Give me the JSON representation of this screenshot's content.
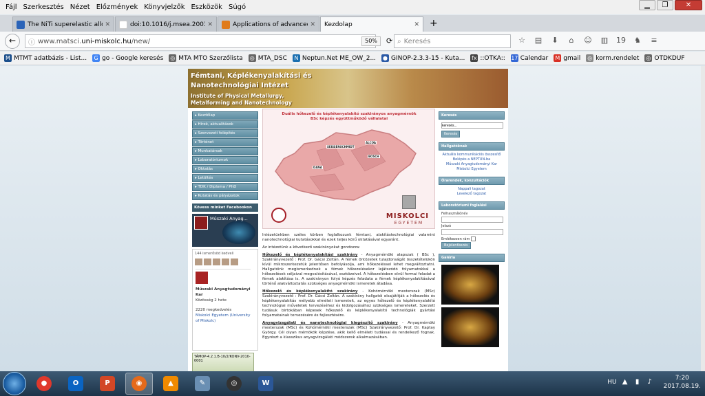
{
  "menu": [
    "Fájl",
    "Szerkesztés",
    "Nézet",
    "Előzmények",
    "Könyvjelzők",
    "Eszközök",
    "Súgó"
  ],
  "window_controls": {
    "minimize": "▁",
    "maximize": "❐",
    "close": "✕"
  },
  "tabs": [
    {
      "label": "The NiTi superelastic alloy ap",
      "favicon_color": "#2a63b8"
    },
    {
      "label": "doi:10.1016/j.msea.2003.12.061 - S",
      "favicon_color": "#ffffff"
    },
    {
      "label": "Applications of advanced tra",
      "favicon_color": "#e07b1a"
    },
    {
      "label": "Kezdolap",
      "favicon_color": "#ffffff",
      "active": true
    }
  ],
  "nav": {
    "back_icon": "←",
    "url_prefix": "www.matsci.",
    "url_domain": "uni-miskolc.hu",
    "url_suffix": "/new/",
    "zoom": "50%",
    "search_placeholder": "Keresés",
    "new_tab": "+",
    "reload": "⟳",
    "icons": [
      "☆",
      "▤",
      "⬇",
      "⌂",
      "☺",
      "▥",
      "19",
      "♞",
      "≡"
    ]
  },
  "bookmarks": [
    {
      "label": "MTMT adatbázis - List...",
      "color": "#1b4f8c"
    },
    {
      "label": "go - Google keresés",
      "color": "#4285f4"
    },
    {
      "label": "MTA MTO Szerzőlista",
      "color": "#666"
    },
    {
      "label": "MTA_DSC",
      "color": "#666"
    },
    {
      "label": "Neptun.Net ME_OW_2...",
      "color": "#1a6fb0"
    },
    {
      "label": "GINOP-2.3.3-15 - Kuta...",
      "color": "#2b5aa6"
    },
    {
      "label": "::OTKA::",
      "color": "#444"
    },
    {
      "label": "Calendar",
      "color": "#3367d6"
    },
    {
      "label": "gmail",
      "color": "#d93025"
    },
    {
      "label": "korm.rendelet",
      "color": "#888"
    },
    {
      "label": "OTDKDUF",
      "color": "#666"
    }
  ],
  "site": {
    "title_hu": "Fémtani, Képlékenyalakítási és Nanotechnológiai Intézet",
    "title_en": "Institute of Physical Metallurgy, Metalforming and Nanotechnology",
    "nav_items": [
      "Kezdőlap",
      "Hírek, aktualitások",
      "Szervezeti felépítés",
      "Történet",
      "Munkatársak",
      "Laboratóriumok",
      "Oktatás",
      "Letöltés",
      "TDK / Diploma / PhD",
      "Kutatás és pályázatok"
    ],
    "facebook_title": "Kövess minket Facebookon is!",
    "fb_name": "Műszaki Anyag...",
    "fb_likes": "144 ismerősöd kedveli",
    "profile_name": "Műszaki Anyagtudományi Kar",
    "profile_sub": "Közösség 2 hete",
    "profile_count": "2220 megkedvelés",
    "profile_text": "Miskolci Egyetem (University of Miskolc)",
    "tamop": "TÁMOP-4.2.1.B-10/2/KONV-2010-0001",
    "map_title": "Duális hőkezelő és képlékenyalakító szakirányos anyagmérnök BSc képzés együttműködő vállalatai",
    "map_logo": "MISKOLCI",
    "map_logo_sub": "EGYETEM",
    "map_labels": [
      "SEISSENSCHMIDT",
      "ALCOA",
      "DANA",
      "BOSCH"
    ],
    "intro": "Intézetünkben széles körben foglalkozunk fémtani, alakítástechnológiai valamint nanotechnológiai kutatásokkal és ezek teljes körű oktatásával egyaránt.",
    "intro2": "Az intézetünk a következő szakirányokat gondozza:",
    "s1_title": "Hőkezelő és képlékenyalakítási szakirány",
    "s1_text": "- Anyagmérnöki alapszak ( BSc ), Szakirányvezető : Prof. Dr. Gácsi Zoltán. A fémek öntözetek tulajdonságát összetételükön kívül mikroszerkezetük jelentősen befolyásolja, ami hőkezeléssel lehet megváltoztatni. Hallgatóink megismerkednek a fémek hőkezelésekor lejátszódó folyamatokkal a hőkezelések céljaival megvalósításával, eszközeivel. A hőkezelésben elvül formai feladat a fémek alakítása is. A szakirányon folyó képzés feladata a fémek képlékenyalakításával történő alakváltoztatás szükséges anyagmérnöki ismeretek átadása.",
    "s2_title": "Hőkezelő és képlékenyalakító szakirány",
    "s2_text": "- Kohómérnöki mesterszak (MSc) Szakirányvezető : Prof. Dr. Gácsi Zoltán. A szakirány hallgatói elsajátítják a hőkezelés és képlékenyalakítás mélyebb elméleti ismereteit, az egyes hőkezelő és képlékenyalakító technológiai műveletek tervezéséhez és kidolgozásához szükséges ismereteket. Szerzett tudásuk birtokában képesek hőkezelő és képlékenyalakító technológiák gyártási folyamatainak tervezésére és fejlesztésére.",
    "s3_title": "Anyagvizsgálati és nanotechnológiai kiegészítő szakirány",
    "s3_text": "- Anyagmérnöki mesterszak (MSc) és Kohómérnöki mesterszak (MSc) Szakirányvezető: Prof. Dr. Kaptay György. Cél olyan mérnökök képzése, akik kellő elméleti tudással és rendelkező fognak. Egyrészt a klasszikus anyagvizsgálati módszerek alkalmazásában.",
    "right": {
      "search_head": "Keresés",
      "search_value": "keresés...",
      "search_btn": "Keresés",
      "students_head": "Hallgatóknak",
      "students_links": [
        "Aktuális kommunikációs összesítő",
        "Belépés a NEPTUN-ba",
        "Műszaki Anyagtudományi Kar",
        "Miskolci Egyetem"
      ],
      "hours_head": "Órarendek, konzultációk",
      "hours_links": [
        "Nappali tagozat",
        "Levelező tagozat"
      ],
      "login_head": "Laboratóriumi foglalási rendszer",
      "user_label": "Felhasználónév",
      "pass_label": "Jelszó",
      "remember": "Emlékezzen rám",
      "login_btn": "Bejelentkezés",
      "gallery_head": "Galéria"
    }
  },
  "taskbar": {
    "apps": [
      {
        "name": "chrome",
        "color": "#e0382c",
        "label": "●"
      },
      {
        "name": "outlook",
        "color": "#0a64c2",
        "label": "O"
      },
      {
        "name": "powerpoint",
        "color": "#d24726",
        "label": "P"
      },
      {
        "name": "firefox",
        "color": "#e56a1b",
        "label": "◉",
        "active": true
      },
      {
        "name": "vlc",
        "color": "#f08a00",
        "label": "▲"
      },
      {
        "name": "tool",
        "color": "#6a8fb3",
        "label": "✎"
      },
      {
        "name": "obs",
        "color": "#333",
        "label": "◎"
      },
      {
        "name": "word",
        "color": "#2b5797",
        "label": "W"
      }
    ],
    "lang": "HU",
    "time": "7:20",
    "date": "2017.08.19."
  }
}
